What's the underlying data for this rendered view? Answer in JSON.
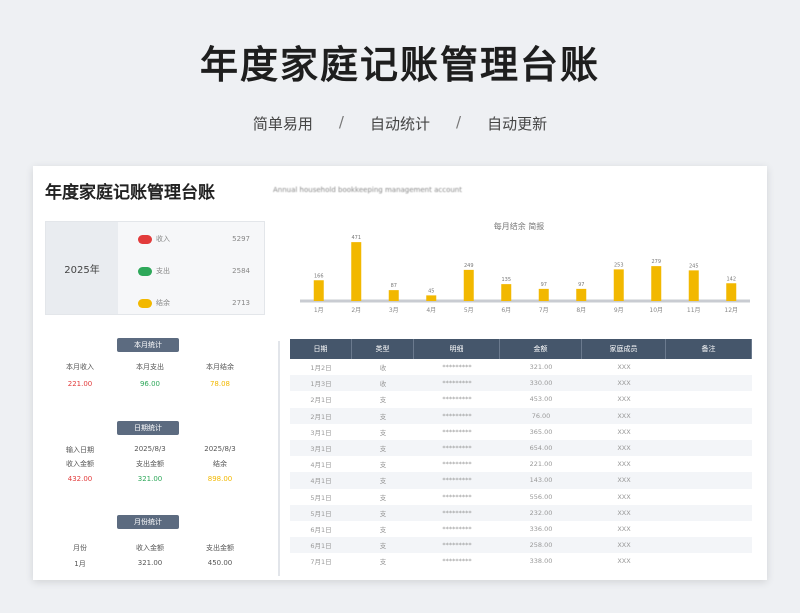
{
  "page": {
    "title": "年度家庭记账管理台账",
    "features": [
      "简单易用",
      "自动统计",
      "自动更新"
    ],
    "separator": "/"
  },
  "sheet": {
    "title": "年度家庭记账管理台账",
    "desc": "Annual household bookkeeping management account",
    "year": "2025年",
    "summary": [
      {
        "label": "收入",
        "value": "5297",
        "color": "#e23b3b"
      },
      {
        "label": "支出",
        "value": "2584",
        "color": "#2ea85a"
      },
      {
        "label": "结余",
        "value": "2713",
        "color": "#f2b800"
      }
    ]
  },
  "chart_data": {
    "type": "bar",
    "title": "每月结余 简报",
    "categories": [
      "1月",
      "2月",
      "3月",
      "4月",
      "5月",
      "6月",
      "7月",
      "8月",
      "9月",
      "10月",
      "11月",
      "12月"
    ],
    "values": [
      166,
      471,
      87,
      45,
      249,
      135,
      97,
      97,
      253,
      279,
      245,
      142
    ],
    "ylim": [
      0,
      520
    ],
    "color": "#f2b800"
  },
  "panels": {
    "month": {
      "badge": "本月统计",
      "headers": [
        "本月收入",
        "本月支出",
        "本月结余"
      ],
      "values": [
        "221.00",
        "96.00",
        "78.08"
      ],
      "colors": [
        "#e23b3b",
        "#2ea85a",
        "#f2b800"
      ]
    },
    "date": {
      "badge": "日期统计",
      "headers": [
        "输入日期",
        "2025/8/3",
        "2025/8/3"
      ],
      "sub": [
        "收入金额",
        "支出金额",
        "结余"
      ],
      "values": [
        "432.00",
        "321.00",
        "898.00"
      ],
      "colors": [
        "#e23b3b",
        "#2ea85a",
        "#f2b800"
      ]
    },
    "query": {
      "badge": "月份统计",
      "headers": [
        "月份",
        "收入金额",
        "支出金额"
      ],
      "values": [
        "1月",
        "321.00",
        "450.00"
      ]
    }
  },
  "table": {
    "headers": [
      "日期",
      "类型",
      "明细",
      "金额",
      "家庭成员",
      "备注"
    ],
    "rows": [
      [
        "1月2日",
        "收",
        "*********",
        "321.00",
        "XXX"
      ],
      [
        "1月3日",
        "收",
        "*********",
        "330.00",
        "XXX"
      ],
      [
        "2月1日",
        "支",
        "*********",
        "453.00",
        "XXX"
      ],
      [
        "2月1日",
        "支",
        "*********",
        "76.00",
        "XXX"
      ],
      [
        "3月1日",
        "支",
        "*********",
        "365.00",
        "XXX"
      ],
      [
        "3月1日",
        "支",
        "*********",
        "654.00",
        "XXX"
      ],
      [
        "4月1日",
        "支",
        "*********",
        "221.00",
        "XXX"
      ],
      [
        "4月1日",
        "支",
        "*********",
        "143.00",
        "XXX"
      ],
      [
        "5月1日",
        "支",
        "*********",
        "556.00",
        "XXX"
      ],
      [
        "5月1日",
        "支",
        "*********",
        "232.00",
        "XXX"
      ],
      [
        "6月1日",
        "支",
        "*********",
        "336.00",
        "XXX"
      ],
      [
        "6月1日",
        "支",
        "*********",
        "258.00",
        "XXX"
      ],
      [
        "7月1日",
        "支",
        "*********",
        "338.00",
        "XXX"
      ]
    ]
  }
}
